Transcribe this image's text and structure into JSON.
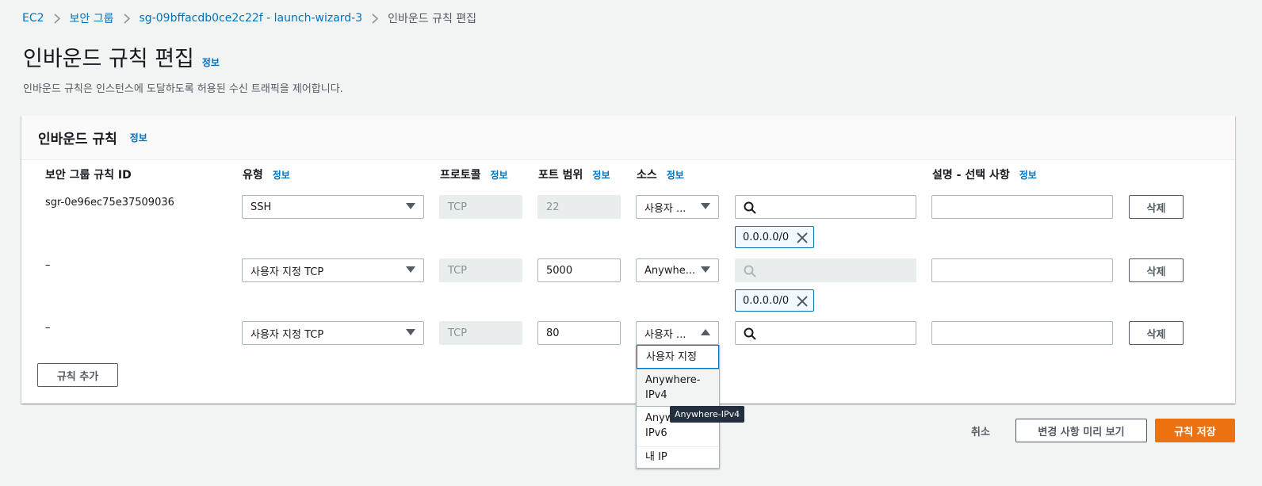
{
  "breadcrumb": {
    "items": [
      "EC2",
      "보안 그룹",
      "sg-09bffacdb0ce2c22f - launch-wizard-3"
    ],
    "current": "인바운드 규칙 편집"
  },
  "page": {
    "title": "인바운드 규칙 편집",
    "info_label": "정보",
    "description": "인바운드 규칙은 인스턴스에 도달하도록 허용된 수신 트래픽을 제어합니다."
  },
  "panel": {
    "title": "인바운드 규칙",
    "info_label": "정보",
    "columns": {
      "rule_id": "보안 그룹 규칙 ID",
      "type": "유형",
      "protocol": "프로토콜",
      "port_range": "포트 범위",
      "source": "소스",
      "description": "설명 - 선택 사항",
      "info": "정보"
    },
    "rows": [
      {
        "rule_id": "sgr-0e96ec75e37509036",
        "type": "SSH",
        "protocol": "TCP",
        "port": "22",
        "source": "사용자 ...",
        "token": "0.0.0.0/0",
        "delete": "삭제"
      },
      {
        "rule_id": "–",
        "type": "사용자 지정 TCP",
        "protocol": "TCP",
        "port": "5000",
        "source": "Anywhe...",
        "token": "0.0.0.0/0",
        "delete": "삭제"
      },
      {
        "rule_id": "–",
        "type": "사용자 지정 TCP",
        "protocol": "TCP",
        "port": "80",
        "source": "사용자 ...",
        "delete": "삭제"
      }
    ],
    "add_rule": "규칙 추가"
  },
  "dropdown": {
    "options": [
      "사용자 지정",
      "Anywhere-IPv4",
      "Anywhere-IPv6",
      "내 IP"
    ],
    "option_lines": [
      [
        "사용자 지정"
      ],
      [
        "Anywhere-",
        "IPv4"
      ],
      [
        "Anyw",
        "IPv6"
      ],
      [
        "내 IP"
      ]
    ],
    "tooltip": "Anywhere-IPv4"
  },
  "footer": {
    "cancel": "취소",
    "preview": "변경 사항 미리 보기",
    "save": "규칙 저장"
  },
  "colors": {
    "primary": "#ec7211",
    "link": "#0073bb"
  },
  "icons": [
    "chevron-right-icon",
    "search-icon",
    "close-icon",
    "caret-down-icon",
    "caret-up-icon"
  ]
}
